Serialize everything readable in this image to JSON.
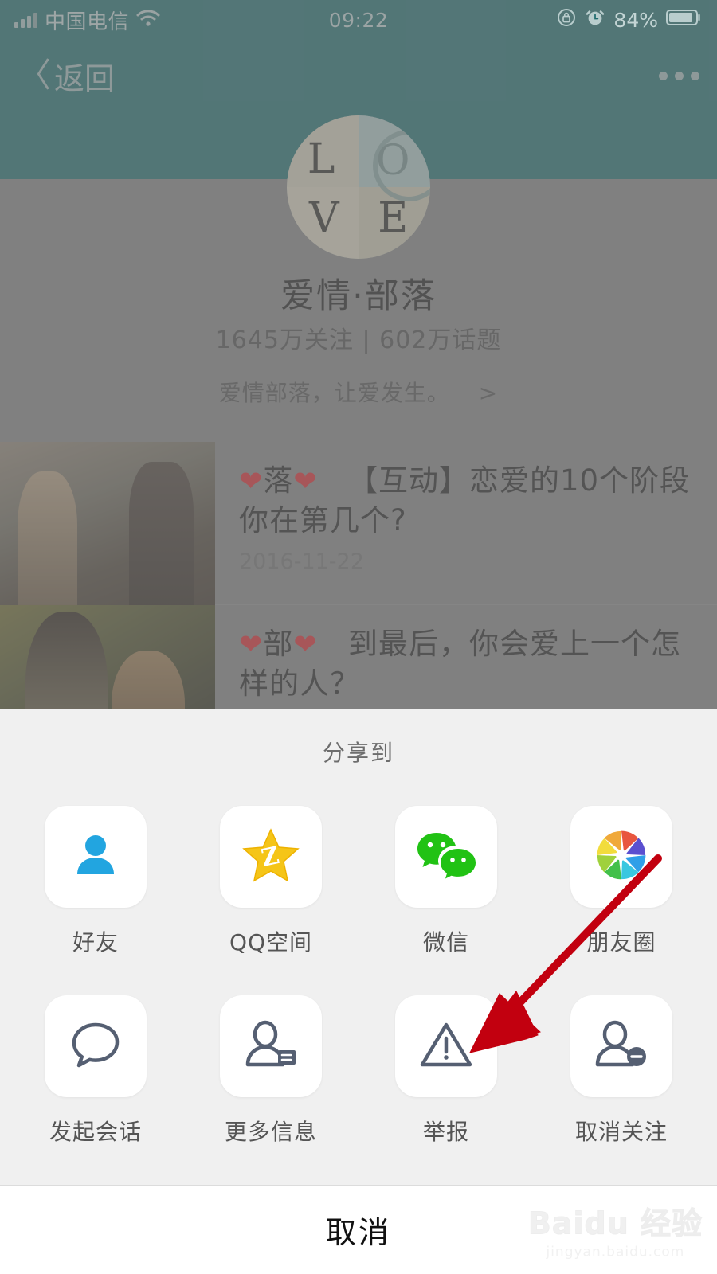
{
  "status_bar": {
    "carrier": "中国电信",
    "wifi_icon": "wifi-icon",
    "signal_icon": "signal-bars-icon",
    "time": "09:22",
    "rotation_lock_icon": "rotation-lock-icon",
    "alarm_icon": "alarm-clock-icon",
    "battery_percent": "84%",
    "battery_icon": "battery-icon"
  },
  "navbar": {
    "back_label": "返回",
    "back_icon": "chevron-left-icon",
    "more_icon": "more-horizontal-icon"
  },
  "profile": {
    "avatar_icon": "avatar-love-tiles",
    "avatar_letters": [
      "L",
      "O",
      "V",
      "E"
    ],
    "name": "爱情·部落",
    "stats": "1645万关注 | 602万话题",
    "tagline": "爱情部落，让爱发生。",
    "tagline_arrow": ">"
  },
  "articles": [
    {
      "title": "❤落❤　【互动】恋爱的10个阶段 你在第几个?",
      "title_prefix_heart": "❤",
      "title_tag": "落",
      "title_text": "【互动】恋爱的10个阶段 你在第几个?",
      "date": "2016-11-22",
      "thumb_icon": "article-thumbnail"
    },
    {
      "title": "❤部❤　到最后，你会爱上一个怎样的人？",
      "title_prefix_heart": "❤",
      "title_tag": "部",
      "title_text": "到最后，你会爱上一个怎样的人？",
      "date": "",
      "thumb_icon": "article-thumbnail"
    }
  ],
  "share_sheet": {
    "title": "分享到",
    "rows": [
      [
        {
          "label": "好友",
          "icon": "qq-friend-icon"
        },
        {
          "label": "QQ空间",
          "icon": "qzone-star-icon"
        },
        {
          "label": "微信",
          "icon": "wechat-icon"
        },
        {
          "label": "朋友圈",
          "icon": "moments-aperture-icon"
        }
      ],
      [
        {
          "label": "发起会话",
          "icon": "chat-bubble-icon"
        },
        {
          "label": "更多信息",
          "icon": "person-card-icon"
        },
        {
          "label": "举报",
          "icon": "warning-triangle-icon"
        },
        {
          "label": "取消关注",
          "icon": "person-minus-icon"
        }
      ]
    ],
    "cancel_label": "取消"
  },
  "annotation": {
    "arrow_icon": "red-arrow-pointer",
    "arrow_color": "#c2000f",
    "points_to": "取消关注"
  },
  "watermark": {
    "main": "Baidu 经验",
    "sub": "jingyan.baidu.com"
  },
  "colors": {
    "header_teal": "#1c6a6c",
    "dim_gray": "#808080",
    "sheet_bg": "#f0f0f0",
    "arrow_red": "#c2000f",
    "heart_red": "#d8252a"
  }
}
